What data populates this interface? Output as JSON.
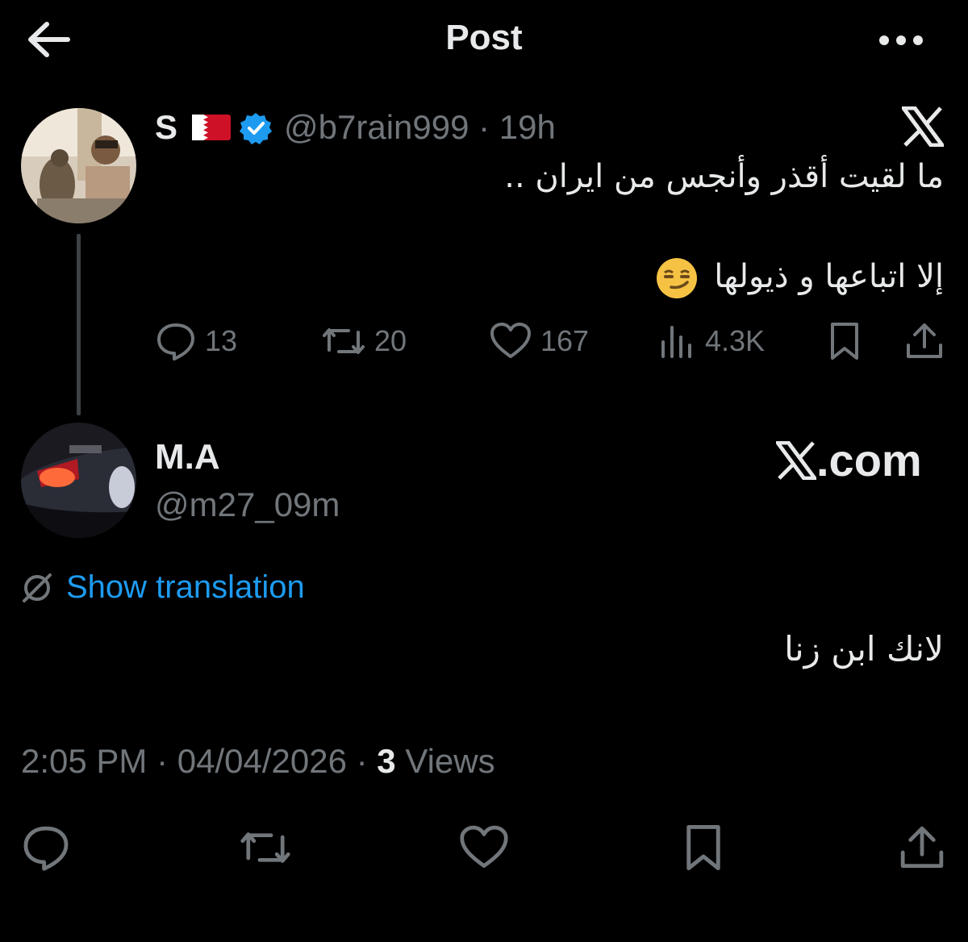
{
  "header": {
    "title": "Post"
  },
  "quoted_post": {
    "name": "S",
    "handle": "@b7rain999",
    "time": "19h",
    "line1": "ما لقيت أقذر وأنجس من ايران ..",
    "line2": "إلا اتباعها و ذيولها",
    "emoji": "smirk-emoji",
    "stats": {
      "replies": "13",
      "reposts": "20",
      "likes": "167",
      "views": "4.3K"
    }
  },
  "reply": {
    "name": "M.A",
    "handle": "@m27_09m",
    "watermark": ".com",
    "translate_label": "Show translation",
    "text": "لانك ابن زنا",
    "time": "2:05 PM",
    "date": "04/04/2026",
    "views_count": "3",
    "views_label": "Views"
  },
  "colors": {
    "accent": "#1d9bf0",
    "muted": "#71767b",
    "text": "#e7e9ea",
    "background": "#000000"
  }
}
